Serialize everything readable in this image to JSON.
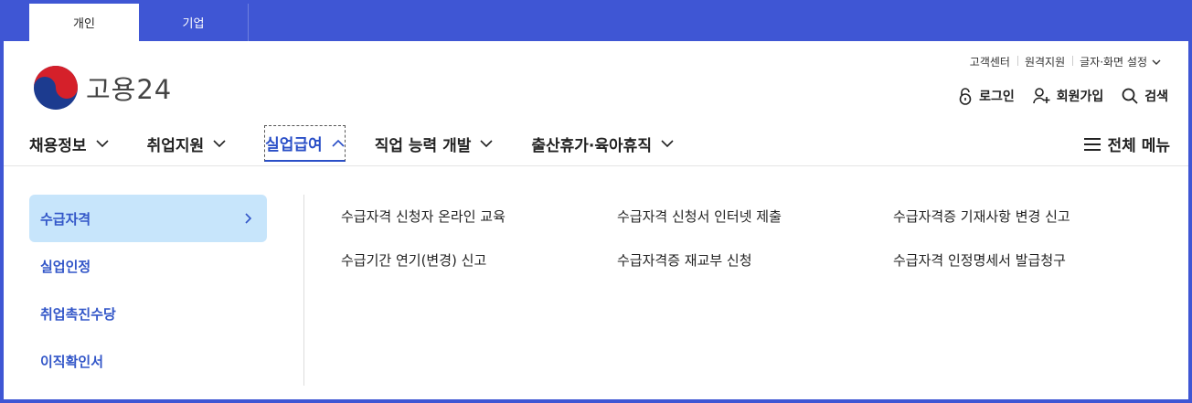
{
  "top_tabs": [
    {
      "label": "개인"
    },
    {
      "label": "기업"
    }
  ],
  "util": {
    "customer_center": "고객센터",
    "remote_support": "원격지원",
    "display_settings": "글자·화면 설정"
  },
  "logo": {
    "text": "고용24"
  },
  "account": {
    "login": "로그인",
    "signup": "회원가입",
    "search": "검색"
  },
  "nav": {
    "items": [
      {
        "label": "채용정보"
      },
      {
        "label": "취업지원"
      },
      {
        "label": "실업급여"
      },
      {
        "label": "직업 능력 개발"
      },
      {
        "label": "출산휴가·육아휴직"
      }
    ],
    "all_menu": "전체 메뉴"
  },
  "submenu": {
    "sidebar": [
      {
        "label": "수급자격"
      },
      {
        "label": "실업인정"
      },
      {
        "label": "취업촉진수당"
      },
      {
        "label": "이직확인서"
      }
    ],
    "links": [
      "수급자격 신청자 온라인 교육",
      "수급자격 신청서 인터넷 제출",
      "수급자격증 기재사항 변경 신고",
      "수급기간 연기(변경) 신고",
      "수급자격증 재교부 신청",
      "수급자격 인정명세서 발급청구"
    ]
  },
  "colors": {
    "frame": "#3f56d4",
    "accent": "#2a4fc7",
    "active_bg": "#c7e5fb"
  }
}
